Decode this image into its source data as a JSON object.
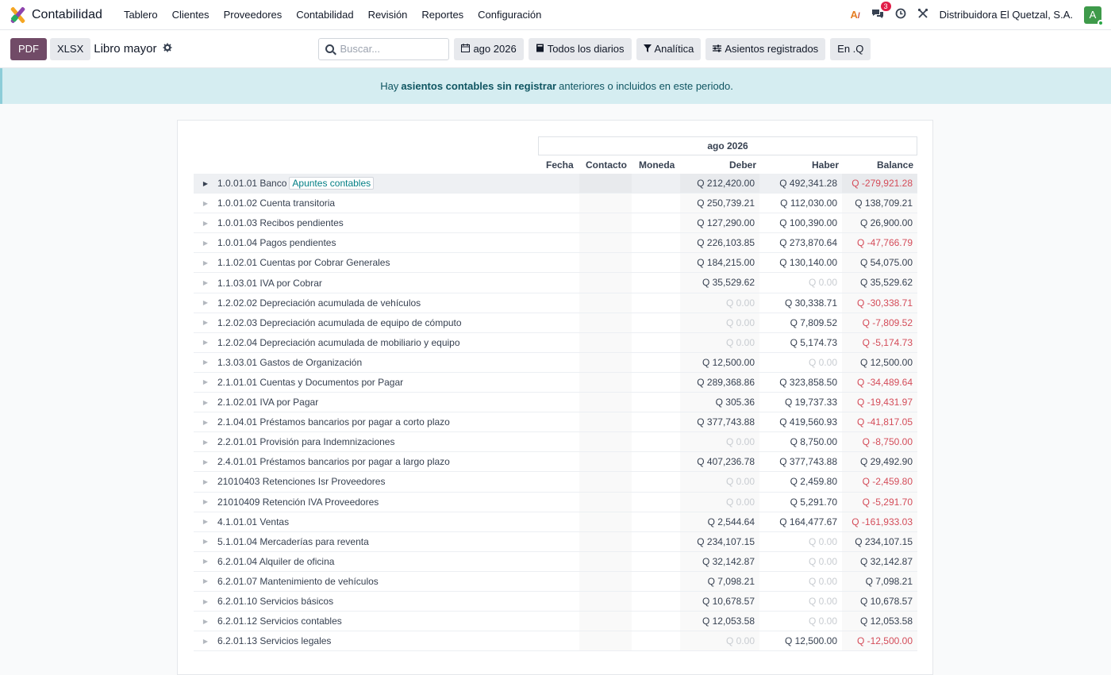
{
  "navbar": {
    "app_name": "Contabilidad",
    "menu": [
      "Tablero",
      "Clientes",
      "Proveedores",
      "Contabilidad",
      "Revisión",
      "Reportes",
      "Configuración"
    ],
    "messages_badge": "3",
    "company": "Distribuidora El Quetzal, S.A.",
    "avatar_letter": "A"
  },
  "control": {
    "pdf_label": "PDF",
    "xlsx_label": "XLSX",
    "breadcrumb": "Libro mayor",
    "search_placeholder": "Buscar...",
    "filters": [
      {
        "icon": "calendar-icon",
        "label": "ago 2026"
      },
      {
        "icon": "book-icon",
        "label": "Todos los diarios"
      },
      {
        "icon": "filter-icon",
        "label": "Analítica"
      },
      {
        "icon": "sliders-icon",
        "label": "Asientos registrados"
      },
      {
        "icon": "",
        "label": "En .Q"
      }
    ]
  },
  "alert": {
    "prefix": "Hay",
    "link": "asientos contables sin registrar",
    "suffix": "anteriores o incluidos en este periodo."
  },
  "report": {
    "period": "ago 2026",
    "columns": {
      "fecha": "Fecha",
      "contacto": "Contacto",
      "moneda": "Moneda",
      "debe": "Deber",
      "haber": "Haber",
      "balance": "Balance"
    },
    "first_row_pill": "Apuntes contables",
    "rows": [
      {
        "account": "1.0.01.01 Banco",
        "debe": "Q 212,420.00",
        "haber": "Q 492,341.28",
        "balance": "Q -279,921.28"
      },
      {
        "account": "1.0.01.02 Cuenta transitoria",
        "debe": "Q 250,739.21",
        "haber": "Q 112,030.00",
        "balance": "Q 138,709.21"
      },
      {
        "account": "1.0.01.03 Recibos pendientes",
        "debe": "Q 127,290.00",
        "haber": "Q 100,390.00",
        "balance": "Q 26,900.00"
      },
      {
        "account": "1.0.01.04 Pagos pendientes",
        "debe": "Q 226,103.85",
        "haber": "Q 273,870.64",
        "balance": "Q -47,766.79"
      },
      {
        "account": "1.1.02.01 Cuentas por Cobrar Generales",
        "debe": "Q 184,215.00",
        "haber": "Q 130,140.00",
        "balance": "Q 54,075.00"
      },
      {
        "account": "1.1.03.01 IVA por Cobrar",
        "debe": "Q 35,529.62",
        "haber": "Q 0.00",
        "balance": "Q 35,529.62"
      },
      {
        "account": "1.2.02.02 Depreciación acumulada de vehículos",
        "debe": "Q 0.00",
        "haber": "Q 30,338.71",
        "balance": "Q -30,338.71"
      },
      {
        "account": "1.2.02.03 Depreciación acumulada de equipo de cómputo",
        "debe": "Q 0.00",
        "haber": "Q 7,809.52",
        "balance": "Q -7,809.52"
      },
      {
        "account": "1.2.02.04 Depreciación acumulada de mobiliario y equipo",
        "debe": "Q 0.00",
        "haber": "Q 5,174.73",
        "balance": "Q -5,174.73"
      },
      {
        "account": "1.3.03.01 Gastos de Organización",
        "debe": "Q 12,500.00",
        "haber": "Q 0.00",
        "balance": "Q 12,500.00"
      },
      {
        "account": "2.1.01.01 Cuentas y Documentos por Pagar",
        "debe": "Q 289,368.86",
        "haber": "Q 323,858.50",
        "balance": "Q -34,489.64"
      },
      {
        "account": "2.1.02.01 IVA por Pagar",
        "debe": "Q 305.36",
        "haber": "Q 19,737.33",
        "balance": "Q -19,431.97"
      },
      {
        "account": "2.1.04.01 Préstamos bancarios por pagar a corto plazo",
        "debe": "Q 377,743.88",
        "haber": "Q 419,560.93",
        "balance": "Q -41,817.05"
      },
      {
        "account": "2.2.01.01 Provisión para Indemnizaciones",
        "debe": "Q 0.00",
        "haber": "Q 8,750.00",
        "balance": "Q -8,750.00"
      },
      {
        "account": "2.4.01.01 Préstamos bancarios por pagar a largo plazo",
        "debe": "Q 407,236.78",
        "haber": "Q 377,743.88",
        "balance": "Q 29,492.90"
      },
      {
        "account": "21010403 Retenciones Isr Proveedores",
        "debe": "Q 0.00",
        "haber": "Q 2,459.80",
        "balance": "Q -2,459.80"
      },
      {
        "account": "21010409 Retención IVA Proveedores",
        "debe": "Q 0.00",
        "haber": "Q 5,291.70",
        "balance": "Q -5,291.70"
      },
      {
        "account": "4.1.01.01 Ventas",
        "debe": "Q 2,544.64",
        "haber": "Q 164,477.67",
        "balance": "Q -161,933.03"
      },
      {
        "account": "5.1.01.04 Mercaderías para reventa",
        "debe": "Q 234,107.15",
        "haber": "Q 0.00",
        "balance": "Q 234,107.15"
      },
      {
        "account": "6.2.01.04 Alquiler de oficina",
        "debe": "Q 32,142.87",
        "haber": "Q 0.00",
        "balance": "Q 32,142.87"
      },
      {
        "account": "6.2.01.07 Mantenimiento de vehículos",
        "debe": "Q 7,098.21",
        "haber": "Q 0.00",
        "balance": "Q 7,098.21"
      },
      {
        "account": "6.2.01.10 Servicios básicos",
        "debe": "Q 10,678.57",
        "haber": "Q 0.00",
        "balance": "Q 10,678.57"
      },
      {
        "account": "6.2.01.12 Servicios contables",
        "debe": "Q 12,053.58",
        "haber": "Q 0.00",
        "balance": "Q 12,053.58"
      },
      {
        "account": "6.2.01.13 Servicios legales",
        "debe": "Q 0.00",
        "haber": "Q 12,500.00",
        "balance": "Q -12,500.00"
      }
    ]
  }
}
